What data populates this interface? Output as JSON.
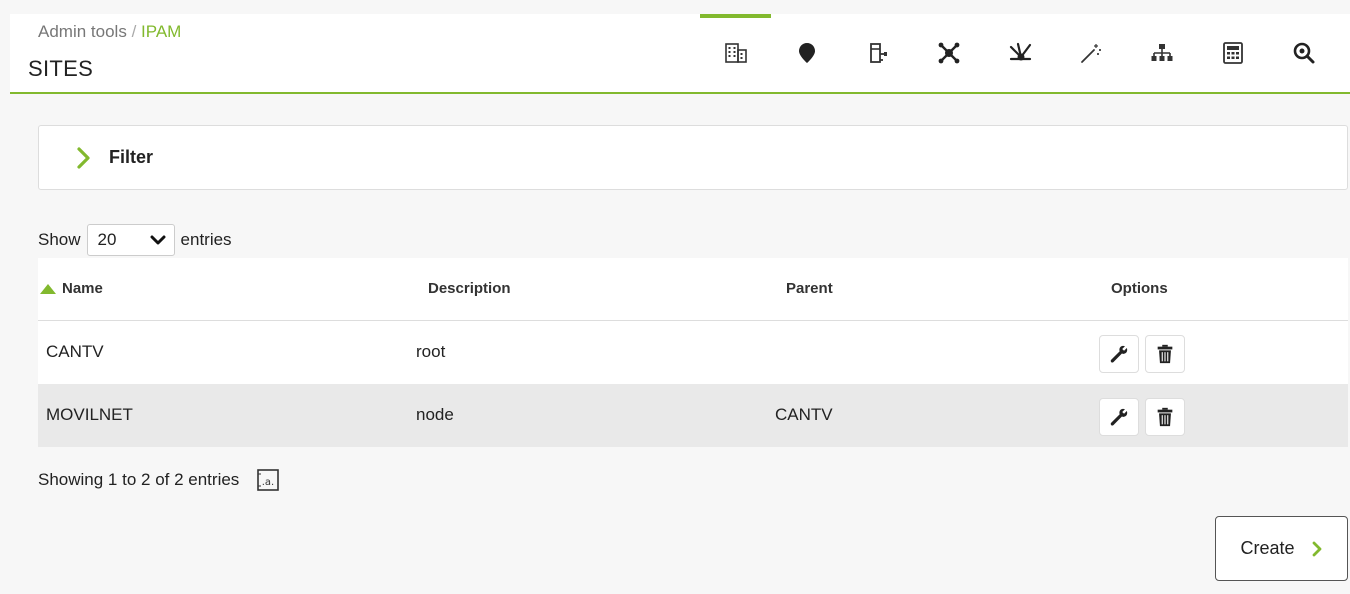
{
  "header": {
    "breadcrumb_root": "Admin tools",
    "breadcrumb_separator": "/",
    "breadcrumb_current": "IPAM",
    "title": "SITES",
    "accent_color": "#82b92e",
    "tabs": [
      {
        "icon": "building-icon",
        "active": true
      },
      {
        "icon": "location-pin-icon",
        "active": false
      },
      {
        "icon": "subnet-tree-icon",
        "active": false
      },
      {
        "icon": "network-nodes-icon",
        "active": false
      },
      {
        "icon": "network-branch-icon",
        "active": false
      },
      {
        "icon": "magic-wand-icon",
        "active": false
      },
      {
        "icon": "hierarchy-icon",
        "active": false
      },
      {
        "icon": "calculator-icon",
        "active": false
      },
      {
        "icon": "search-zoom-icon",
        "active": false
      }
    ]
  },
  "filter": {
    "label": "Filter"
  },
  "entries": {
    "show_label": "Show",
    "selected": "20",
    "suffix_label": "entries"
  },
  "table": {
    "columns": {
      "name": "Name",
      "description": "Description",
      "parent": "Parent",
      "options": "Options"
    },
    "rows": [
      {
        "name": "CANTV",
        "description": "root",
        "parent": ""
      },
      {
        "name": "MOVILNET",
        "description": "node",
        "parent": "CANTV"
      }
    ]
  },
  "info": {
    "text": "Showing 1 to 2 of 2 entries"
  },
  "actions": {
    "create_label": "Create"
  }
}
